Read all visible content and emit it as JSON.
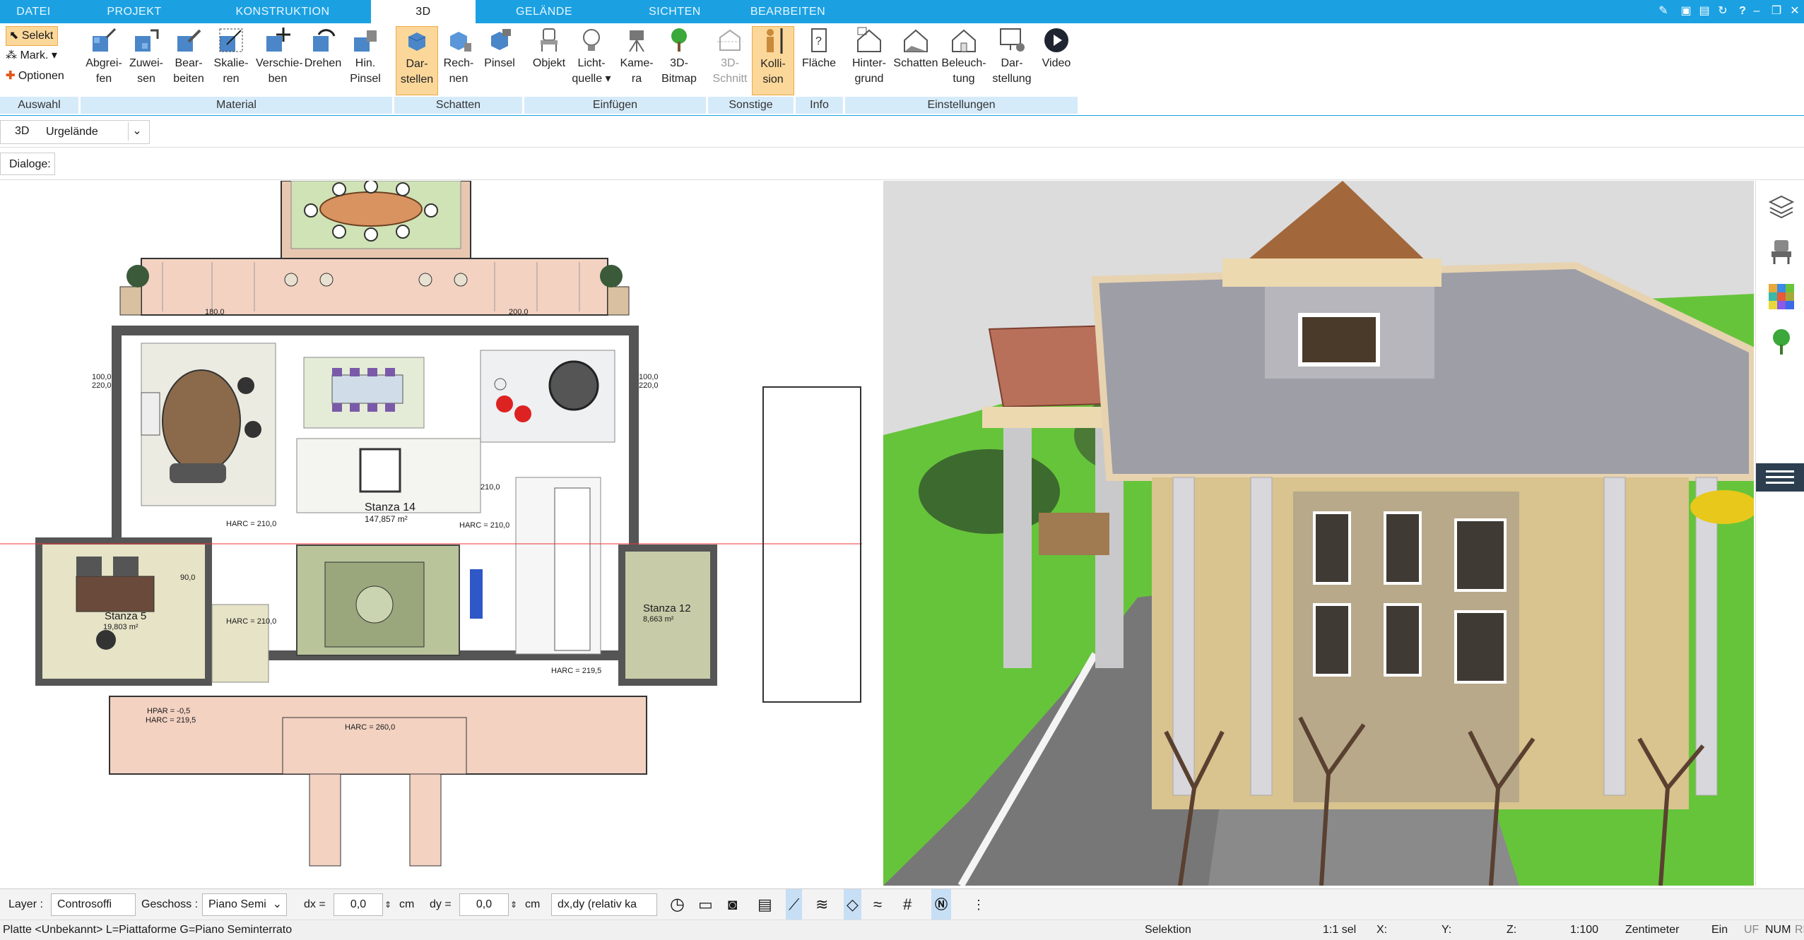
{
  "tabs": [
    "DATEI",
    "PROJEKT",
    "KONSTRUKTION",
    "3D",
    "GELÄNDE",
    "SICHTEN",
    "BEARBEITEN"
  ],
  "active_tab": "3D",
  "auswahl": {
    "selekt": "Selekt",
    "mark": "Mark.",
    "optionen": "Optionen",
    "footer": "Auswahl"
  },
  "groups": {
    "material": {
      "footer": "Material",
      "buttons": [
        "Abgrei-\nfen",
        "Zuwei-\nsen",
        "Bear-\nbeiten",
        "Skalie-\nren",
        "Verschie-\nben",
        "Drehen",
        "Hin.\nPinsel"
      ]
    },
    "schatten": {
      "footer": "Schatten",
      "buttons": [
        "Dar-\nstellen",
        "Rech-\nnen",
        "Pinsel"
      ]
    },
    "einfuegen": {
      "footer": "Einfügen",
      "buttons": [
        "Objekt",
        "Licht-\nquelle",
        "Kame-\nra",
        "3D-\nBitmap"
      ]
    },
    "sonstige": {
      "footer": "Sonstige",
      "buttons": [
        "3D-\nSchnitt",
        "Kolli-\nsion"
      ]
    },
    "info": {
      "footer": "Info",
      "buttons": [
        "Fläche"
      ]
    },
    "einstellungen": {
      "footer": "Einstellungen",
      "buttons": [
        "Hinter-\ngrund",
        "Schatten",
        "Beleuch-\ntung",
        "Dar-\nstellung",
        "Video"
      ]
    }
  },
  "view_bar": {
    "mode": "3D",
    "terrain": "Urgelände"
  },
  "dialoge_label": "Dialoge:",
  "plan": {
    "rooms": [
      {
        "name": "Stanza 14",
        "area": "147,857 m²"
      },
      {
        "name": "Stanza 5",
        "area": "19,803 m²"
      },
      {
        "name": "Stanza 12",
        "area": "8,663 m²"
      }
    ],
    "labels": [
      "HARC = 210,0",
      "HPAR = -0,5",
      "HARC = 219,5",
      "HARC = 260,0",
      "100,0",
      "220,0",
      "90,0",
      "180,0",
      "200,0",
      "210,0"
    ]
  },
  "bottom_bar": {
    "layer_label": "Layer :",
    "layer_value": "Controsoffi",
    "geschoss_label": "Geschoss :",
    "geschoss_value": "Piano Semi",
    "dx_label": "dx =",
    "dx_value": "0,0",
    "dx_unit": "cm",
    "dy_label": "dy =",
    "dy_value": "0,0",
    "dy_unit": "cm",
    "mode_value": "dx,dy (relativ ka"
  },
  "status": {
    "left": "Platte <Unbekannt> L=Piattaforme G=Piano Seminterrato",
    "selektion": "Selektion",
    "sel": "1:1 sel",
    "x": "X:",
    "y": "Y:",
    "z": "Z:",
    "scale": "1:100",
    "unit": "Zentimeter",
    "ein": "Ein",
    "uf": "UF",
    "num": "NUM",
    "rf": "RF"
  },
  "colors": {
    "accent": "#1ba1e2",
    "selected": "#fbd79a",
    "group_footer": "#d6ebfa"
  }
}
